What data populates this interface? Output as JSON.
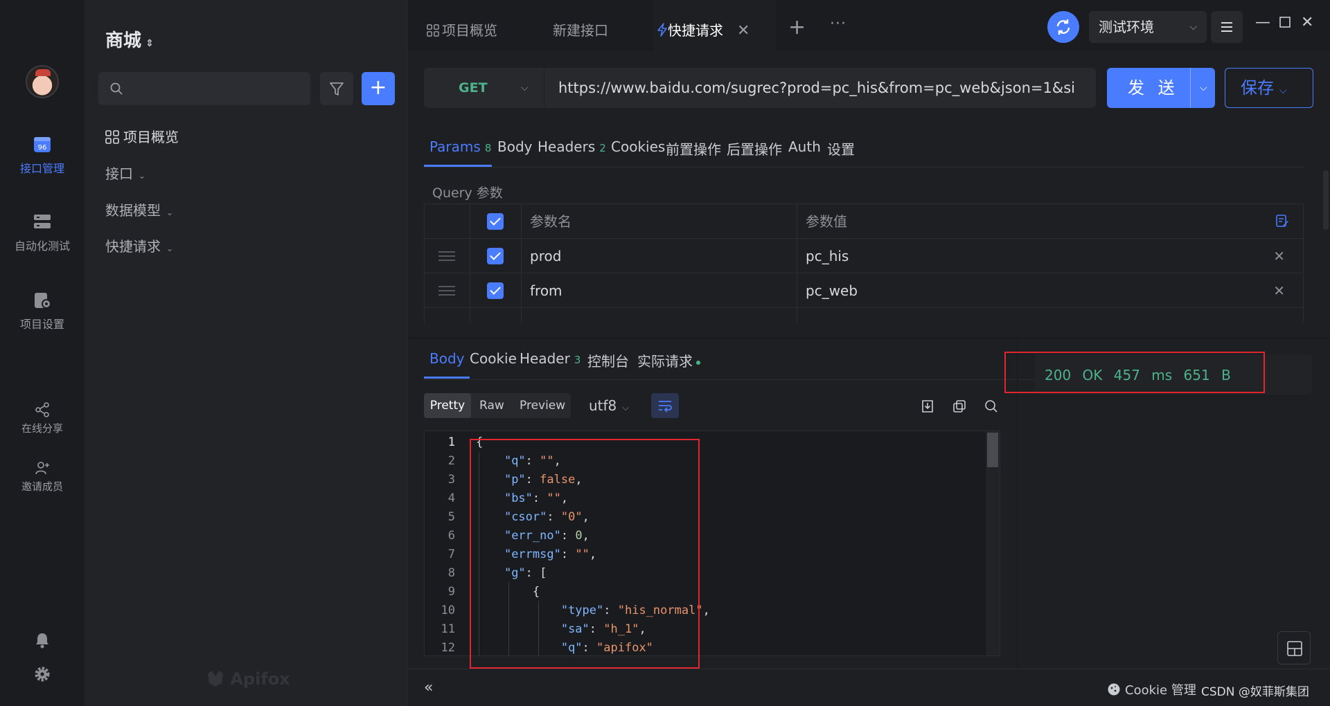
{
  "rail": {
    "items": [
      {
        "label": "接口管理",
        "icon": "api-management-icon",
        "active": true
      },
      {
        "label": "自动化测试",
        "icon": "automation-test-icon"
      },
      {
        "label": "项目设置",
        "icon": "project-settings-icon"
      }
    ],
    "share_label": "在线分享",
    "invite_label": "邀请成员"
  },
  "sidebar": {
    "project_name": "商城",
    "search_placeholder": "",
    "overview_label": "项目概览",
    "tree": [
      "接口",
      "数据模型",
      "快捷请求"
    ],
    "brand": "Apifox"
  },
  "tabs": [
    {
      "label": "项目概览",
      "icon": "grid-icon"
    },
    {
      "label": "新建接口"
    },
    {
      "label": "快捷请求",
      "icon": "lightning-icon",
      "active": true
    }
  ],
  "env": {
    "name": "测试环境"
  },
  "request": {
    "method": "GET",
    "url": "https://www.baidu.com/sugrec?prod=pc_his&from=pc_web&json=1&si",
    "send_label": "发 送",
    "save_label": "保存"
  },
  "request_tabs": [
    {
      "label": "Params",
      "count": "8",
      "active": true
    },
    {
      "label": "Body"
    },
    {
      "label": "Headers",
      "count": "2"
    },
    {
      "label": "Cookies"
    },
    {
      "label": "前置操作"
    },
    {
      "label": "后置操作"
    },
    {
      "label": "Auth"
    },
    {
      "label": "设置"
    }
  ],
  "params": {
    "title": "Query 参数",
    "col_name": "参数名",
    "col_value": "参数值",
    "rows": [
      {
        "name": "prod",
        "value": "pc_his"
      },
      {
        "name": "from",
        "value": "pc_web"
      }
    ]
  },
  "response": {
    "tabs": [
      {
        "label": "Body",
        "active": true
      },
      {
        "label": "Cookie"
      },
      {
        "label": "Header",
        "count": "3"
      },
      {
        "label": "控制台"
      },
      {
        "label": "实际请求",
        "dot": true
      }
    ],
    "formats": [
      "Pretty",
      "Raw",
      "Preview"
    ],
    "active_format": "Pretty",
    "encoding": "utf8",
    "status": "200 OK",
    "time": "457 ms",
    "size": "651 B"
  },
  "code_lines": [
    "{",
    "    \"q\": \"\",",
    "    \"p\": false,",
    "    \"bs\": \"\",",
    "    \"csor\": \"0\",",
    "    \"err_no\": 0,",
    "    \"errmsg\": \"\",",
    "    \"g\": [",
    "        {",
    "            \"type\": \"his_normal\",",
    "            \"sa\": \"h_1\",",
    "            \"q\": \"apifox\""
  ],
  "bottom": {
    "collapse": "«",
    "cookie_label": "Cookie 管理",
    "watermark": "CSDN @奴菲斯集团"
  },
  "colors": {
    "accent": "#4a7cff",
    "success": "#4cb38a",
    "highlight_box": "#e3262d"
  }
}
